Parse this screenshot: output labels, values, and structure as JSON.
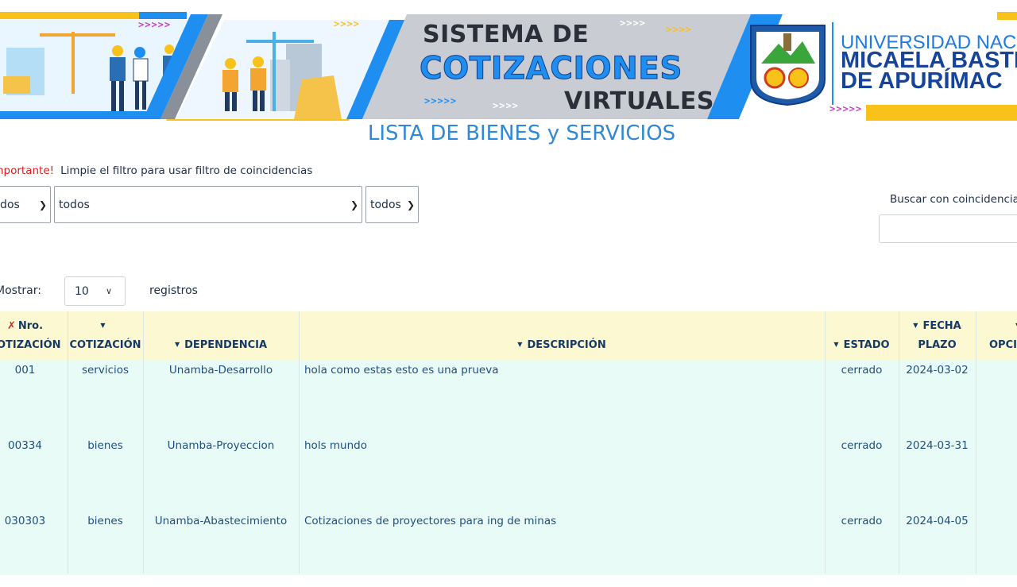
{
  "banner": {
    "title_line1": "SISTEMA DE",
    "title_line2": "COTIZACIONES",
    "title_line3": "VIRTUALES",
    "university_line1": "UNIVERSIDAD NACIONAL",
    "university_line2": "MICAELA BASTIDAS",
    "university_line3": "DE APURÍMAC",
    "logo_icon": "university-seal-icon",
    "colors": {
      "blue": "#1e8ff0",
      "yellow": "#f9c21a",
      "navy": "#16449a"
    }
  },
  "page": {
    "title": "LISTA DE BIENES y SERVICIOS"
  },
  "notice": {
    "important": "¡Importante!",
    "message": "Limpie el filtro para usar filtro de coincidencias"
  },
  "filters": {
    "type_value": "todos",
    "dependency_value": "todos",
    "state_value": "todos",
    "search_label": "Buscar con coincidencias:",
    "search_value": ""
  },
  "length_menu": {
    "show_label": "Mostrar:",
    "value": "10",
    "records_label": "registros"
  },
  "table": {
    "headers": {
      "nro_line1": "Nro.",
      "nro_line2": "COTIZACIÓN",
      "tipo": "COTIZACIÓN",
      "dependencia": "DEPENDENCIA",
      "descripcion": "DESCRIPCIÓN",
      "estado": "ESTADO",
      "fecha_line1": "FECHA",
      "fecha_line2": "PLAZO",
      "opciones": "OPCIONES"
    },
    "rows": [
      {
        "nro": "001",
        "tipo": "servicios",
        "dependencia": "Unamba-Desarrollo",
        "descripcion": "hola como estas esto es una prueva",
        "estado": "cerrado",
        "fecha": "2024-03-02"
      },
      {
        "nro": "00334",
        "tipo": "bienes",
        "dependencia": "Unamba-Proyeccion",
        "descripcion": "hols mundo",
        "estado": "cerrado",
        "fecha": "2024-03-31"
      },
      {
        "nro": "030303",
        "tipo": "bienes",
        "dependencia": "Unamba-Abastecimiento",
        "descripcion": "Cotizaciones de proyectores para ing de minas",
        "estado": "cerrado",
        "fecha": "2024-04-05"
      }
    ]
  }
}
